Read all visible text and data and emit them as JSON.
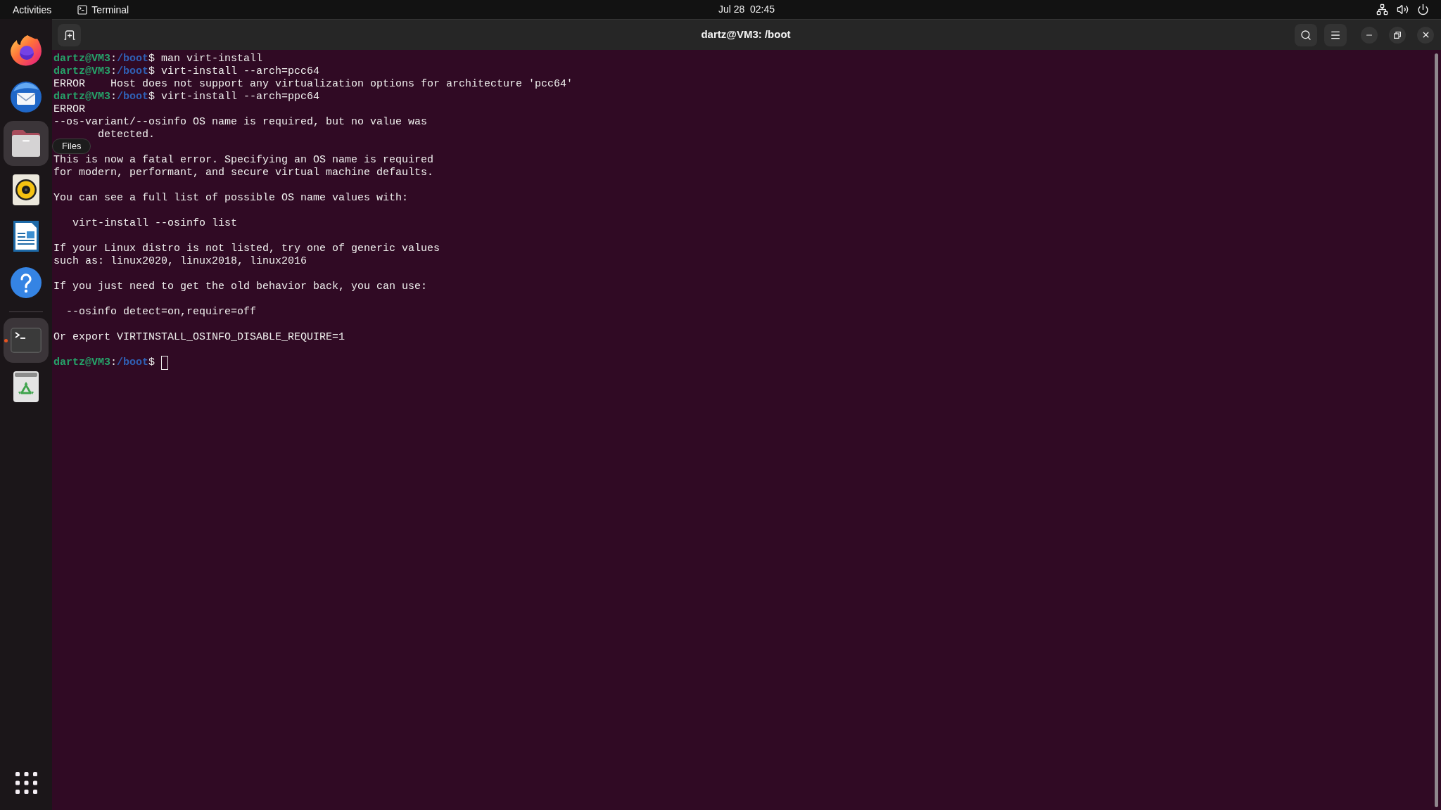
{
  "top_bar": {
    "activities": "Activities",
    "app_menu": "Terminal",
    "clock": "Jul 28  02:45"
  },
  "dock": {
    "items": [
      {
        "kind": "browser",
        "highlighted": false,
        "running": false
      },
      {
        "kind": "mail",
        "highlighted": false,
        "running": false
      },
      {
        "kind": "files",
        "highlighted": true,
        "running": false
      },
      {
        "kind": "music",
        "highlighted": false,
        "running": false
      },
      {
        "kind": "writer",
        "highlighted": false,
        "running": false
      },
      {
        "kind": "help",
        "highlighted": false,
        "running": false
      },
      {
        "kind": "separator"
      },
      {
        "kind": "terminal",
        "highlighted": true,
        "running": true
      },
      {
        "kind": "trash",
        "highlighted": false,
        "running": false
      }
    ],
    "tooltip": "Files"
  },
  "window": {
    "title": "dartz@VM3: /boot"
  },
  "terminal": {
    "lines": [
      {
        "kind": "prompt",
        "user": "dartz@VM3",
        "separator": ":",
        "path": "/boot",
        "symbol": "$",
        "command": "man virt-install",
        "cursor": false
      },
      {
        "kind": "prompt",
        "user": "dartz@VM3",
        "separator": ":",
        "path": "/boot",
        "symbol": "$",
        "command": "virt-install --arch=pcc64",
        "cursor": false
      },
      {
        "kind": "output",
        "text": "ERROR    Host does not support any virtualization options for architecture 'pcc64'"
      },
      {
        "kind": "prompt",
        "user": "dartz@VM3",
        "separator": ":",
        "path": "/boot",
        "symbol": "$",
        "command": "virt-install --arch=ppc64",
        "cursor": false
      },
      {
        "kind": "output",
        "text": "ERROR"
      },
      {
        "kind": "output",
        "text": "--os-variant/--osinfo OS name is required, but no value was"
      },
      {
        "kind": "output",
        "text": "       detected."
      },
      {
        "kind": "blank"
      },
      {
        "kind": "output",
        "text": "This is now a fatal error. Specifying an OS name is required"
      },
      {
        "kind": "output",
        "text": "for modern, performant, and secure virtual machine defaults."
      },
      {
        "kind": "blank"
      },
      {
        "kind": "output",
        "text": "You can see a full list of possible OS name values with:"
      },
      {
        "kind": "blank"
      },
      {
        "kind": "output",
        "text": "   virt-install --osinfo list"
      },
      {
        "kind": "blank"
      },
      {
        "kind": "output",
        "text": "If your Linux distro is not listed, try one of generic values"
      },
      {
        "kind": "output",
        "text": "such as: linux2020, linux2018, linux2016"
      },
      {
        "kind": "blank"
      },
      {
        "kind": "output",
        "text": "If you just need to get the old behavior back, you can use:"
      },
      {
        "kind": "blank"
      },
      {
        "kind": "output",
        "text": "  --osinfo detect=on,require=off"
      },
      {
        "kind": "blank"
      },
      {
        "kind": "output",
        "text": "Or export VIRTINSTALL_OSINFO_DISABLE_REQUIRE=1"
      },
      {
        "kind": "blank"
      },
      {
        "kind": "prompt",
        "user": "dartz@VM3",
        "separator": ":",
        "path": "/boot",
        "symbol": "$",
        "cursor": true
      }
    ]
  }
}
